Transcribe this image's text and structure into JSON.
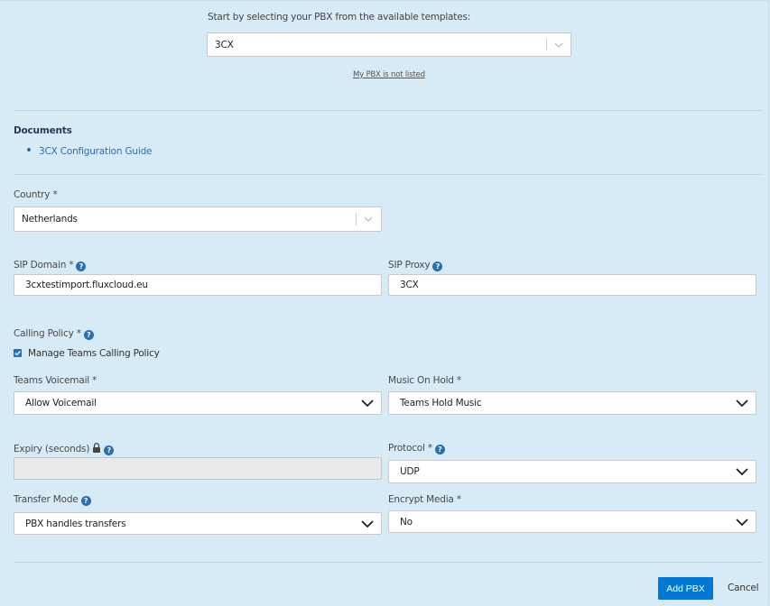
{
  "template": {
    "prompt": "Start by selecting your PBX from the available templates:",
    "selected": "3CX",
    "not_listed_link": "My PBX is not listed"
  },
  "documents": {
    "heading": "Documents",
    "items": [
      "3CX Configuration Guide"
    ]
  },
  "country": {
    "label": "Country *",
    "value": "Netherlands"
  },
  "sip_domain": {
    "label": "SIP Domain *",
    "value": "3cxtestimport.fluxcloud.eu"
  },
  "sip_proxy": {
    "label": "SIP Proxy",
    "value": "3CX"
  },
  "calling_policy": {
    "label": "Calling Policy *",
    "checkbox_label": "Manage Teams Calling Policy",
    "checked": true
  },
  "teams_voicemail": {
    "label": "Teams Voicemail *",
    "value": "Allow Voicemail"
  },
  "music_on_hold": {
    "label": "Music On Hold *",
    "value": "Teams Hold Music"
  },
  "expiry": {
    "label": "Expiry (seconds)",
    "value": ""
  },
  "protocol": {
    "label": "Protocol *",
    "value": "UDP"
  },
  "transfer_mode": {
    "label": "Transfer Mode",
    "value": "PBX handles transfers"
  },
  "encrypt_media": {
    "label": "Encrypt Media *",
    "value": "No"
  },
  "actions": {
    "primary": "Add PBX",
    "cancel": "Cancel"
  },
  "colors": {
    "background": "#d6ebf5",
    "accent": "#0078d4",
    "link": "#2b6fb0",
    "help_icon": "#2b6fb0"
  }
}
